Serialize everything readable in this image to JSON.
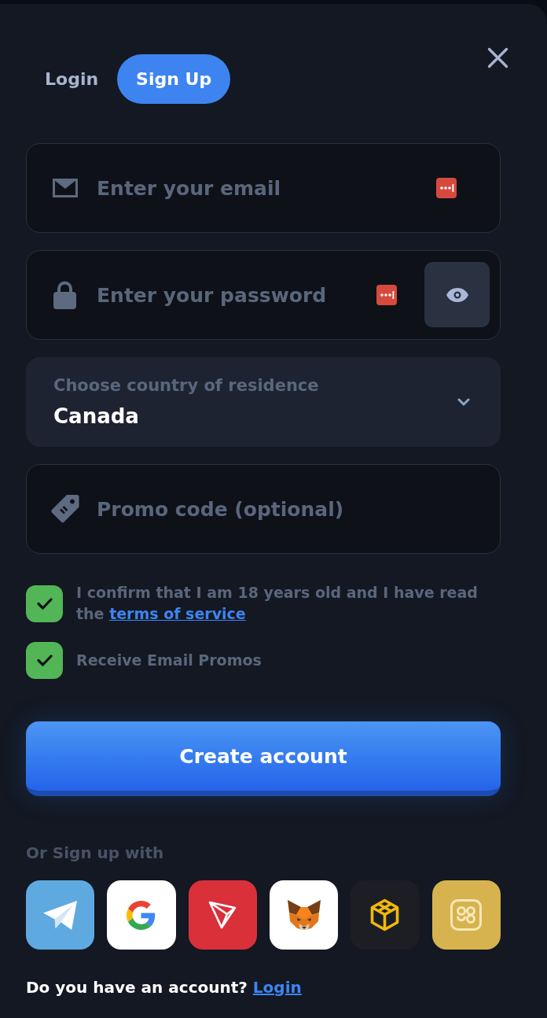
{
  "tabs": [
    {
      "label": "Login",
      "selected": false
    },
    {
      "label": "Sign Up",
      "selected": true
    }
  ],
  "fields": [
    {
      "kind": "email",
      "placeholder": "Enter your email"
    },
    {
      "kind": "password",
      "placeholder": "Enter your password"
    },
    {
      "kind": "select",
      "label": "Choose country of residence",
      "value": "Canada"
    },
    {
      "kind": "promo",
      "placeholder": "Promo code (optional)"
    }
  ],
  "agreements": [
    {
      "text": "I confirm that I am 18 years old and I have read the",
      "link": "terms of service",
      "checked": true
    },
    {
      "text": "Receive Email Promos",
      "checked": true
    }
  ],
  "submit_button": "Create account",
  "social_heading": "Or Sign up with",
  "social_buttons": [
    {
      "kind": "plane"
    },
    {
      "kind": "g"
    },
    {
      "kind": "triangle"
    },
    {
      "kind": "fox"
    },
    {
      "kind": "cube"
    },
    {
      "kind": "glyph"
    }
  ],
  "footer": {
    "text": "Do you have an account?",
    "link": "Login"
  }
}
